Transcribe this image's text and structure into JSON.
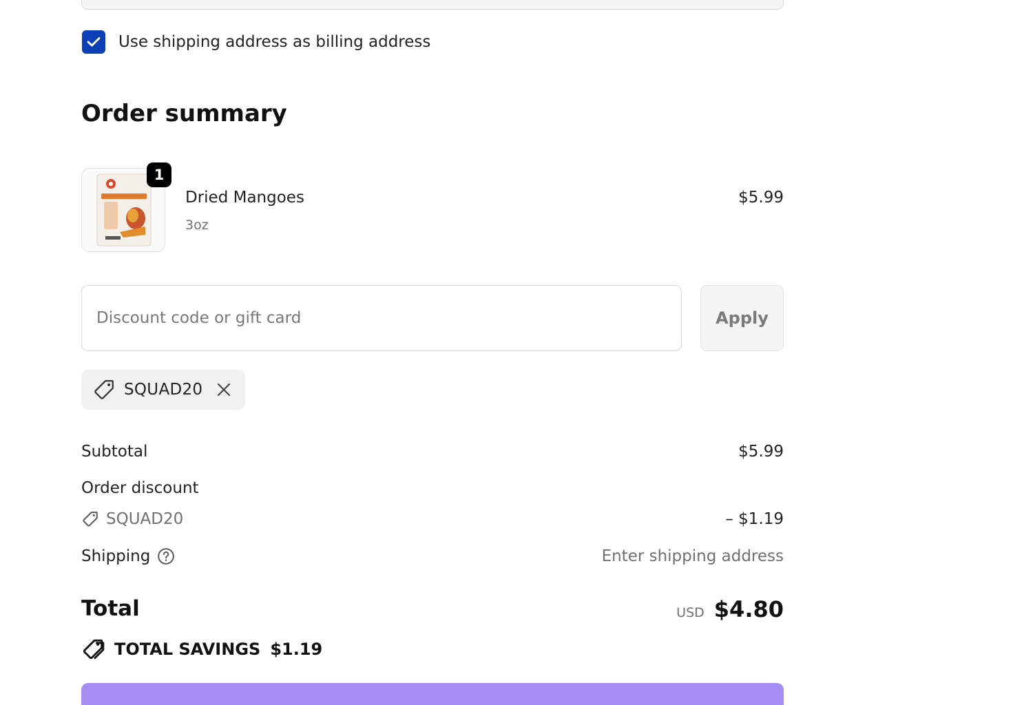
{
  "billing": {
    "checkbox_label": "Use shipping address as billing address",
    "checked": true
  },
  "order_summary": {
    "title": "Order summary",
    "item": {
      "quantity": "1",
      "name": "Dried Mangoes",
      "variant": "3oz",
      "price": "$5.99",
      "image_icon": "product-image-mango-bag"
    }
  },
  "discount": {
    "placeholder": "Discount code or gift card",
    "value": "",
    "apply_label": "Apply",
    "applied_code": "SQUAD20"
  },
  "totals": {
    "subtotal_label": "Subtotal",
    "subtotal_value": "$5.99",
    "order_discount_label": "Order discount",
    "discount_code": "SQUAD20",
    "discount_value": "– $1.19",
    "shipping_label": "Shipping",
    "shipping_value": "Enter shipping address",
    "total_label": "Total",
    "currency": "USD",
    "total_value": "$4.80",
    "savings_label": "TOTAL SAVINGS",
    "savings_value": "$1.19"
  },
  "colors": {
    "checkbox": "#0b3fb5",
    "pay_button": "#a48cf0"
  }
}
